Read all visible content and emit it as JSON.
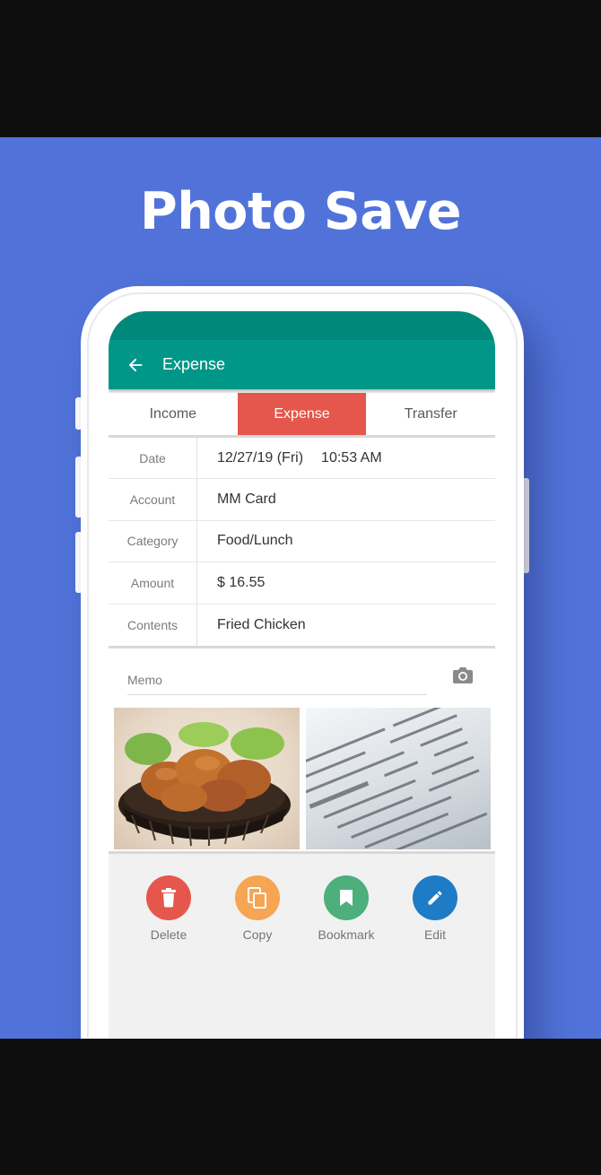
{
  "promo": {
    "title": "Photo Save"
  },
  "appbar": {
    "title": "Expense",
    "back_icon": "arrow-back-icon"
  },
  "tabs": [
    {
      "label": "Income",
      "active": false
    },
    {
      "label": "Expense",
      "active": true
    },
    {
      "label": "Transfer",
      "active": false
    }
  ],
  "form": {
    "date": {
      "label": "Date",
      "value": "12/27/19 (Fri)",
      "time": "10:53 AM"
    },
    "account": {
      "label": "Account",
      "value": "MM Card"
    },
    "category": {
      "label": "Category",
      "value": "Food/Lunch"
    },
    "amount": {
      "label": "Amount",
      "value": "$ 16.55"
    },
    "contents": {
      "label": "Contents",
      "value": "Fried Chicken"
    }
  },
  "memo": {
    "placeholder": "Memo",
    "camera_icon": "camera-icon"
  },
  "photos": [
    {
      "name": "fried-chicken-photo"
    },
    {
      "name": "receipt-photo"
    }
  ],
  "actions": [
    {
      "label": "Delete",
      "icon": "trash-icon",
      "color": "#e5574c"
    },
    {
      "label": "Copy",
      "icon": "copy-icon",
      "color": "#f6a553"
    },
    {
      "label": "Bookmark",
      "icon": "bookmark-icon",
      "color": "#4caf7c"
    },
    {
      "label": "Edit",
      "icon": "pencil-icon",
      "color": "#1e7bc5"
    }
  ],
  "colors": {
    "promo_background": "#5173d9",
    "appbar": "#009688",
    "active_tab": "#e5574c"
  }
}
